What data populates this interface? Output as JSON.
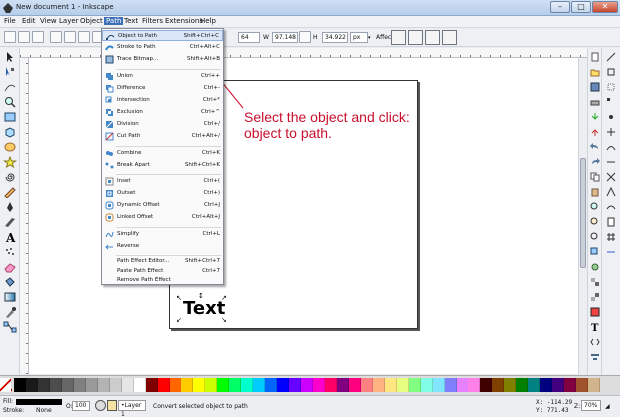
{
  "window": {
    "title": "New document 1 - Inkscape",
    "min": "–",
    "max": "□",
    "close": "✕"
  },
  "menubar": [
    "File",
    "Edit",
    "View",
    "Layer",
    "Object",
    "Path",
    "Text",
    "Filters",
    "Extensions",
    "Help"
  ],
  "toolcontrols": {
    "x_value": "64",
    "w_label": "W",
    "w_value": "97.148",
    "h_label": "H",
    "h_value": "34.922",
    "unit": "px",
    "affect_label": "Affect:"
  },
  "path_menu": {
    "items": [
      {
        "label": "Object to Path",
        "shortcut": "Shift+Ctrl+C",
        "icon": "object-to-path-icon"
      },
      {
        "label": "Stroke to Path",
        "shortcut": "Ctrl+Alt+C",
        "icon": "stroke-to-path-icon"
      },
      {
        "label": "Trace Bitmap...",
        "shortcut": "Shift+Alt+B",
        "icon": "trace-bitmap-icon"
      },
      {
        "label": "Union",
        "shortcut": "Ctrl++",
        "icon": "union-icon"
      },
      {
        "label": "Difference",
        "shortcut": "Ctrl+-",
        "icon": "difference-icon"
      },
      {
        "label": "Intersection",
        "shortcut": "Ctrl+*",
        "icon": "intersection-icon"
      },
      {
        "label": "Exclusion",
        "shortcut": "Ctrl+^",
        "icon": "exclusion-icon"
      },
      {
        "label": "Division",
        "shortcut": "Ctrl+/",
        "icon": "division-icon"
      },
      {
        "label": "Cut Path",
        "shortcut": "Ctrl+Alt+/",
        "icon": "cut-path-icon"
      },
      {
        "label": "Combine",
        "shortcut": "Ctrl+K",
        "icon": "combine-icon"
      },
      {
        "label": "Break Apart",
        "shortcut": "Shift+Ctrl+K",
        "icon": "break-apart-icon"
      },
      {
        "label": "Inset",
        "shortcut": "Ctrl+(",
        "icon": "inset-icon"
      },
      {
        "label": "Outset",
        "shortcut": "Ctrl+)",
        "icon": "outset-icon"
      },
      {
        "label": "Dynamic Offset",
        "shortcut": "Ctrl+J",
        "icon": "dynamic-offset-icon"
      },
      {
        "label": "Linked Offset",
        "shortcut": "Ctrl+Alt+J",
        "icon": "linked-offset-icon"
      },
      {
        "label": "Simplify",
        "shortcut": "Ctrl+L",
        "icon": "simplify-icon"
      },
      {
        "label": "Reverse",
        "shortcut": "",
        "icon": "reverse-icon"
      },
      {
        "label": "Path Effect Editor...",
        "shortcut": "Shift+Ctrl+7",
        "icon": ""
      },
      {
        "label": "Paste Path Effect",
        "shortcut": "Ctrl+7",
        "icon": ""
      },
      {
        "label": "Remove Path Effect",
        "shortcut": "",
        "icon": ""
      }
    ]
  },
  "annotation": "Select the object and click: object to path.",
  "canvas_text": "Text",
  "status": {
    "fill_label": "Fill:",
    "stroke_label": "Stroke:",
    "stroke_value": "None",
    "opacity_label": "O:",
    "opacity_value": "100",
    "layer": "•Layer 1",
    "message": "Convert selected object to path",
    "x_coord": "X: -114.29",
    "y_coord": "Y: 771.43",
    "zoom_label": "Z:",
    "zoom_value": "70%"
  },
  "colors": {
    "accent": "#3d6fb8",
    "annotation": "#c8102e"
  },
  "palette": [
    "#000000",
    "#1a1a1a",
    "#333333",
    "#4d4d4d",
    "#666666",
    "#808080",
    "#999999",
    "#b3b3b3",
    "#cccccc",
    "#e6e6e6",
    "#ffffff",
    "#800000",
    "#ff0000",
    "#ff6600",
    "#ffcc00",
    "#ffff00",
    "#ccff00",
    "#00ff00",
    "#00ff66",
    "#00ffcc",
    "#00ccff",
    "#0066ff",
    "#0000ff",
    "#6600ff",
    "#cc00ff",
    "#ff00cc",
    "#ff0066",
    "#800080",
    "#ff0080",
    "#ff8080",
    "#ffb380",
    "#ffe680",
    "#e6ff80",
    "#80ff80",
    "#80ffe6",
    "#80e6ff",
    "#8080ff",
    "#e680ff",
    "#ff80e6",
    "#400000",
    "#804000",
    "#808000",
    "#008000",
    "#008080",
    "#000080",
    "#400080",
    "#800040",
    "#a0522d",
    "#d2b48c"
  ]
}
